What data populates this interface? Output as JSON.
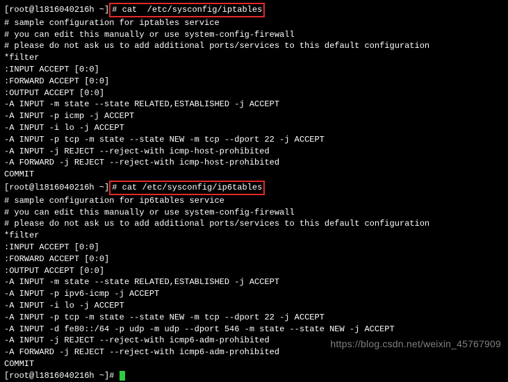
{
  "prompt1_prefix": "[root@l1816040216h ~]",
  "cmd1_hash": "#",
  "cmd1_text": " cat  /etc/sysconfig/iptables",
  "iptables": {
    "l1": "# sample configuration for iptables service",
    "l2": "# you can edit this manually or use system-config-firewall",
    "l3": "# please do not ask us to add additional ports/services to this default configuration",
    "l4": "*filter",
    "l5": ":INPUT ACCEPT [0:0]",
    "l6": ":FORWARD ACCEPT [0:0]",
    "l7": ":OUTPUT ACCEPT [0:0]",
    "l8": "-A INPUT -m state --state RELATED,ESTABLISHED -j ACCEPT",
    "l9": "-A INPUT -p icmp -j ACCEPT",
    "l10": "-A INPUT -i lo -j ACCEPT",
    "l11": "-A INPUT -p tcp -m state --state NEW -m tcp --dport 22 -j ACCEPT",
    "l12": "-A INPUT -j REJECT --reject-with icmp-host-prohibited",
    "l13": "-A FORWARD -j REJECT --reject-with icmp-host-prohibited",
    "l14": "COMMIT"
  },
  "prompt2_prefix": "[root@l1816040216h ~]",
  "cmd2_text": "# cat /etc/sysconfig/ip6tables",
  "ip6tables": {
    "l1": "# sample configuration for ip6tables service",
    "l2": "# you can edit this manually or use system-config-firewall",
    "l3": "# please do not ask us to add additional ports/services to this default configuration",
    "l4": "*filter",
    "l5": ":INPUT ACCEPT [0:0]",
    "l6": ":FORWARD ACCEPT [0:0]",
    "l7": ":OUTPUT ACCEPT [0:0]",
    "l8": "-A INPUT -m state --state RELATED,ESTABLISHED -j ACCEPT",
    "l9": "-A INPUT -p ipv6-icmp -j ACCEPT",
    "l10": "-A INPUT -i lo -j ACCEPT",
    "l11": "-A INPUT -p tcp -m state --state NEW -m tcp --dport 22 -j ACCEPT",
    "l12": "-A INPUT -d fe80::/64 -p udp -m udp --dport 546 -m state --state NEW -j ACCEPT",
    "l13": "-A INPUT -j REJECT --reject-with icmp6-adm-prohibited",
    "l14": "-A FORWARD -j REJECT --reject-with icmp6-adm-prohibited",
    "l15": "COMMIT"
  },
  "prompt3_prefix": "[root@l1816040216h ~]# ",
  "watermark": "https://blog.csdn.net/weixin_45767909"
}
